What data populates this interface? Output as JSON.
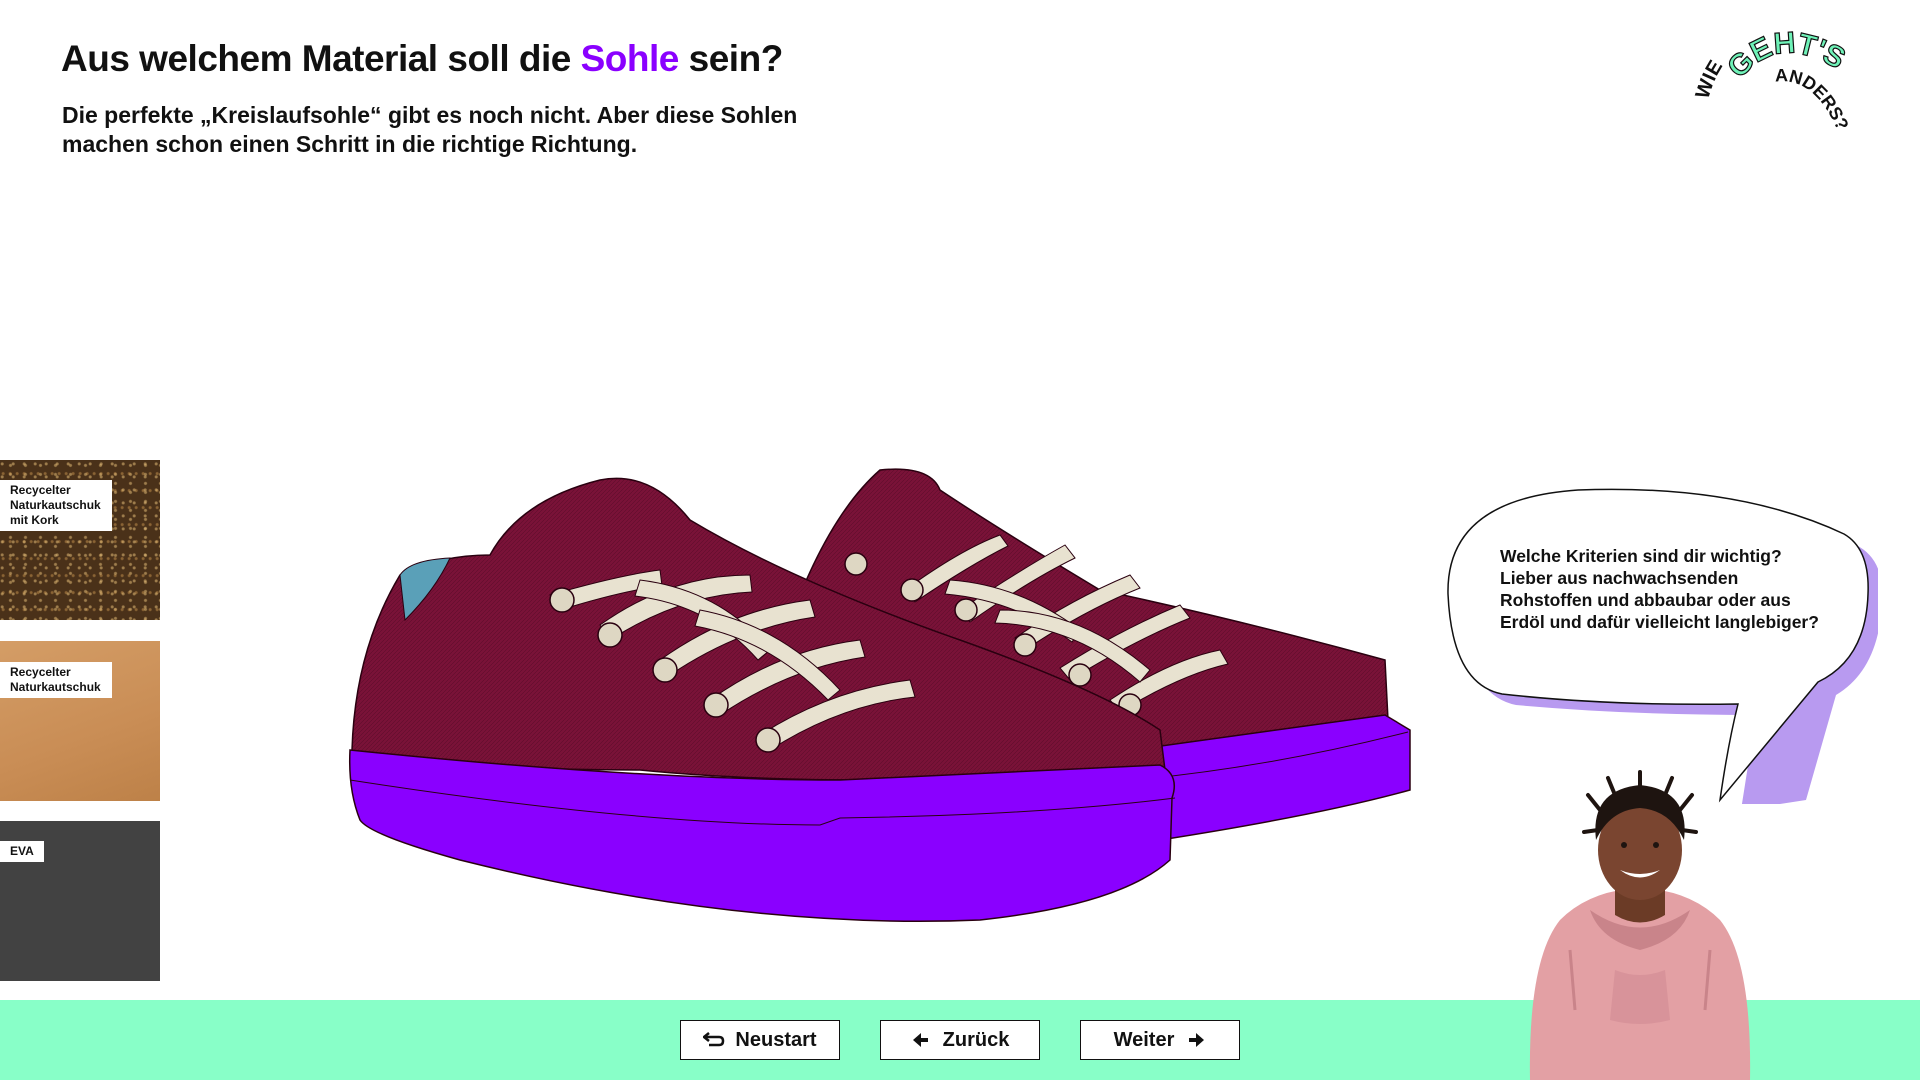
{
  "header": {
    "title_before": "Aus welchem Material soll die ",
    "title_accent": "Sohle",
    "title_after": " sein?",
    "subtitle": "Die perfekte „Kreislaufsohle“ gibt es noch nicht. Aber diese Sohlen machen schon einen Schritt in die richtige Richtung."
  },
  "logo": {
    "word1": "WIE",
    "word2": "GEHT'S",
    "word3": "ANDERS?"
  },
  "materials": [
    {
      "label": "Recycelter Naturkautschuk mit Kork",
      "color": "#4a3119"
    },
    {
      "label": "Recycelter Naturkautschuk",
      "color": "#c98d55"
    },
    {
      "label": "EVA",
      "color": "#424242"
    }
  ],
  "bubble": {
    "text": "Welche Kriterien sind dir wichtig? Lieber aus nachwachsenden Rohstoffen und abbaubar oder aus Erdöl und dafür vielleicht langlebiger?"
  },
  "nav": {
    "restart_label": "Neustart",
    "back_label": "Zurück",
    "next_label": "Weiter"
  },
  "colors": {
    "accent": "#8a00ff",
    "footer": "#88ffc8",
    "upper": "#7a1238",
    "laces": "#e8e2d0",
    "logo_green": "#6ff2b8",
    "bubble_shadow": "#b89af0"
  },
  "icons": {
    "restart": "restart-arrow-icon",
    "back": "arrow-left-icon",
    "next": "arrow-right-icon"
  }
}
